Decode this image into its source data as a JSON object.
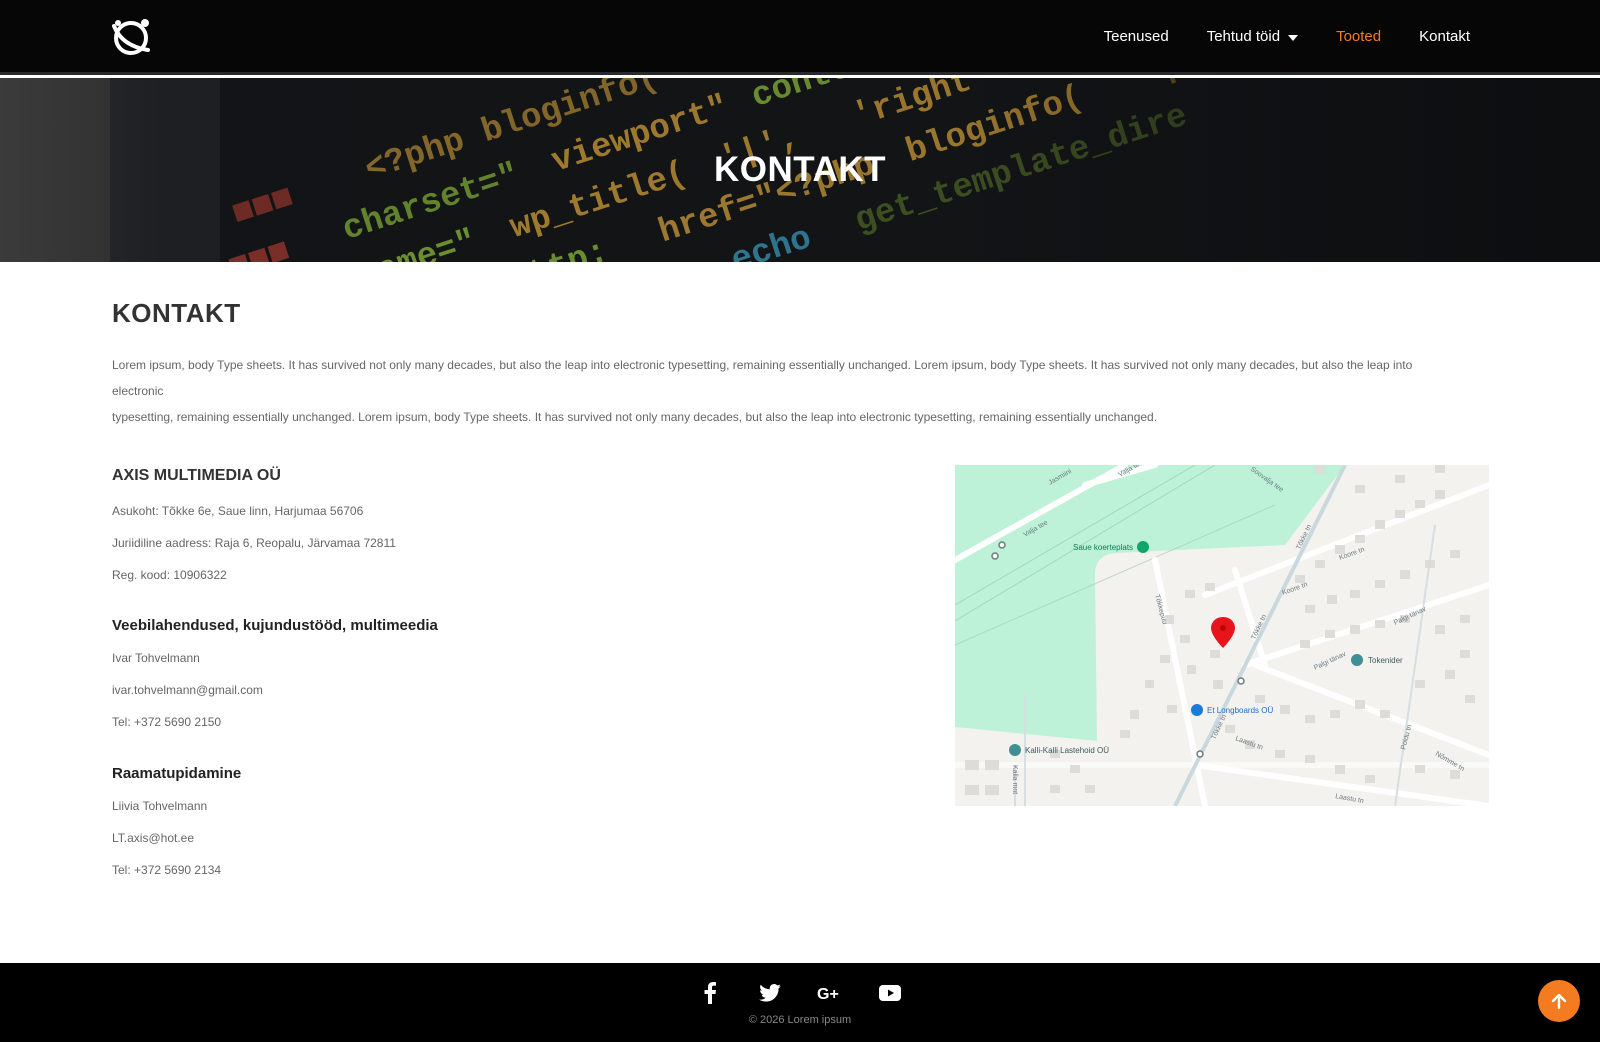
{
  "nav": {
    "logo_icon": "planet-logo-icon",
    "items": [
      {
        "label": "Teenused",
        "active": false
      },
      {
        "label": "Tehtud töid",
        "active": false,
        "has_dropdown": true
      },
      {
        "label": "Tooted",
        "active": true
      },
      {
        "label": "Kontakt",
        "active": false
      }
    ]
  },
  "hero": {
    "title": "KONTAKT",
    "code_lines": [
      "<?php bloginfo(",
      "charset\" content=\"wid",
      "name=\"viewport\" true,",
      "wp_title( '|', 'right",
      "href=\"http://gmpg.org/xfn/",
      "href=\"<?php bloginfo( 'pingback_",
      "?> echo get_template_directory"
    ]
  },
  "page": {
    "heading": "KONTAKT",
    "intro_lines": [
      "Lorem ipsum, body Type sheets. It has survived not only many decades, but also the leap into electronic typesetting, remaining essentially unchanged. Lorem ipsum, body Type sheets. It has survived not only many decades, but also the leap into electronic",
      "typesetting, remaining essentially unchanged. Lorem ipsum, body Type sheets. It has survived not only many decades, but also the leap into electronic typesetting, remaining essentially unchanged."
    ]
  },
  "company": {
    "name": "AXIS MULTIMEDIA OÜ",
    "location": "Asukoht: Tõkke 6e, Saue linn, Harjumaa 56706",
    "legal_address": "Juriidiline aadress: Raja 6, Reopalu, Järvamaa 72811",
    "reg_code": "Reg. kood: 10906322"
  },
  "sections": [
    {
      "title": "Veebilahendused, kujundustööd, multimeedia",
      "person": "Ivar Tohvelmann",
      "email": "ivar.tohvelmann@gmail.com",
      "phone": "Tel: +372 5690 2150"
    },
    {
      "title": "Raamatupidamine",
      "person": "Liivia Tohvelmann",
      "email": "LT.axis@hot.ee",
      "phone": "Tel: +372 5690 2134"
    }
  ],
  "map": {
    "labels": {
      "park": "Saue koerteplats",
      "business1": "Tokenider",
      "business2": "Et Longboards OÜ",
      "business3": "Kalli-Kalli Lastehoid OÜ",
      "street1": "Tõkke tn",
      "street2": "Koore tn",
      "street3": "Palgi tänav",
      "street4": "Laastu tn",
      "street5": "Valja tee",
      "street6": "Tõkkepuu",
      "street7": "Jasmiini",
      "street8": "Soovalja tee",
      "street9": "Nõmme tn",
      "street10": "Pöldu tn",
      "street11": "Kalla mnt"
    },
    "pin_color": "#e8141c"
  },
  "footer": {
    "social": [
      "facebook-icon",
      "twitter-icon",
      "google-plus-icon",
      "youtube-icon"
    ],
    "copyright": "© 2026 Lorem ipsum"
  },
  "colors": {
    "accent": "#f47b20",
    "nav_bg": "#060606",
    "footer_bg": "#000000"
  }
}
